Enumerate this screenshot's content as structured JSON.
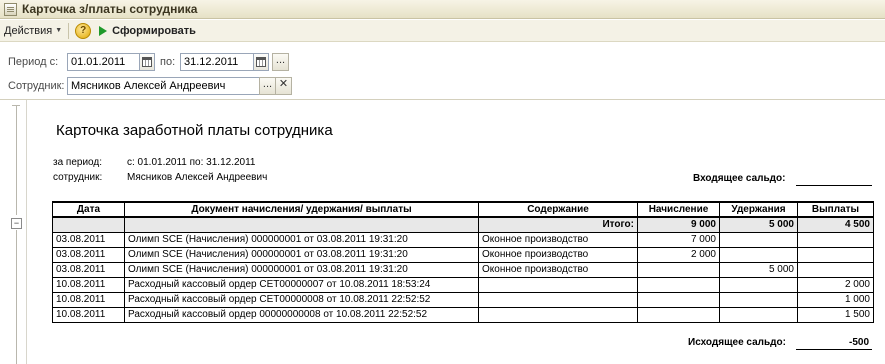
{
  "window": {
    "title": "Карточка з/платы сотрудника"
  },
  "toolbar": {
    "actions_label": "Действия",
    "help_label": "?",
    "run_label": "Сформировать"
  },
  "params": {
    "period_from_label": "Период с:",
    "period_from_value": "01.01.2011",
    "period_to_label": "по:",
    "period_to_value": "31.12.2011",
    "employee_label": "Сотрудник:",
    "employee_value": "Мясников Алексей Андреевич",
    "dots": "...",
    "clear": "✕"
  },
  "report": {
    "title": "Карточка заработной платы сотрудника",
    "period_label": "за период:",
    "period_value": "с: 01.01.2011 по: 31.12.2011",
    "employee_label": "сотрудник:",
    "employee_value": "Мясников  Алексей  Андреевич",
    "opening_balance_label": "Входящее сальдо:",
    "closing_balance_label": "Исходящее сальдо:",
    "closing_balance_value": "-500",
    "columns": [
      "Дата",
      "Документ начисления/ удержания/ выплаты",
      "Содержание",
      "Начисление",
      "Удержания",
      "Выплаты"
    ],
    "total": {
      "label": "Итого:",
      "accrual": "9 000",
      "deduction": "5 000",
      "payment": "4 500"
    },
    "rows": [
      {
        "date": "03.08.2011",
        "doc": "Олимп SCE (Начисления) 000000001 от 03.08.2011 19:31:20",
        "content": "Оконное производство",
        "accrual": "7 000",
        "deduction": "",
        "payment": ""
      },
      {
        "date": "03.08.2011",
        "doc": "Олимп SCE (Начисления) 000000001 от 03.08.2011 19:31:20",
        "content": "Оконное производство",
        "accrual": "2 000",
        "deduction": "",
        "payment": ""
      },
      {
        "date": "03.08.2011",
        "doc": "Олимп SCE (Начисления) 000000001 от 03.08.2011 19:31:20",
        "content": "Оконное производство",
        "accrual": "",
        "deduction": "5 000",
        "payment": ""
      },
      {
        "date": "10.08.2011",
        "doc": "Расходный кассовый ордер СЕТ00000007 от 10.08.2011 18:53:24",
        "content": "",
        "accrual": "",
        "deduction": "",
        "payment": "2 000"
      },
      {
        "date": "10.08.2011",
        "doc": "Расходный кассовый ордер СЕТ00000008 от 10.08.2011 22:52:52",
        "content": "",
        "accrual": "",
        "deduction": "",
        "payment": "1 000"
      },
      {
        "date": "10.08.2011",
        "doc": "Расходный кассовый ордер 00000000008 от 10.08.2011 22:52:52",
        "content": "",
        "accrual": "",
        "deduction": "",
        "payment": "1 500"
      }
    ]
  }
}
